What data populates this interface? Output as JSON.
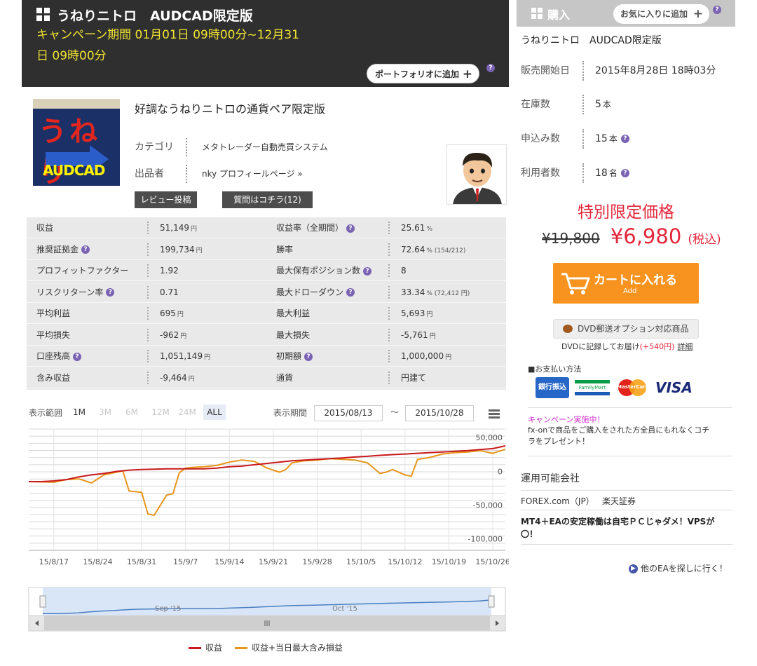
{
  "product": {
    "title": "うねりニトロ　AUDCAD限定版",
    "campaign": "キャンペーン期間 01月01日 09時00分~12月31日 09時00分",
    "portfolio_button": "ポートフォリオに追加",
    "subtitle": "好調なうねりニトロの通貨ペア限定版",
    "category_label": "カテゴリ",
    "category_value": "メタトレーダー自動売買システム",
    "seller_label": "出品者",
    "seller_value": "nky プロフィールページ »",
    "review_button": "レビュー投稿",
    "question_button": "質問はコチラ(12)",
    "thumb_text": "うねり",
    "thumb_name": "AUDCAD"
  },
  "stats": [
    {
      "l_label": "収益",
      "l_help": false,
      "l_value": "51,149",
      "l_unit": "円",
      "r_label": "収益率（全期間）",
      "r_help": true,
      "r_value": "25.61",
      "r_unit": "%",
      "r_extra": ""
    },
    {
      "l_label": "推奨証拠金",
      "l_help": true,
      "l_value": "199,734",
      "l_unit": "円",
      "r_label": "勝率",
      "r_help": false,
      "r_value": "72.64",
      "r_unit": "%",
      "r_extra": "(154/212)"
    },
    {
      "l_label": "プロフィットファクター",
      "l_help": false,
      "l_value": "1.92",
      "l_unit": "",
      "r_label": "最大保有ポジション数",
      "r_help": true,
      "r_value": "8",
      "r_unit": "",
      "r_extra": ""
    },
    {
      "l_label": "リスクリターン率",
      "l_help": true,
      "l_value": "0.71",
      "l_unit": "",
      "r_label": "最大ドローダウン",
      "r_help": true,
      "r_value": "33.34",
      "r_unit": "%",
      "r_extra": "(72,412 円)"
    },
    {
      "l_label": "平均利益",
      "l_help": false,
      "l_value": "695",
      "l_unit": "円",
      "r_label": "最大利益",
      "r_help": false,
      "r_value": "5,693",
      "r_unit": "円",
      "r_extra": ""
    },
    {
      "l_label": "平均損失",
      "l_help": false,
      "l_value": "-962",
      "l_unit": "円",
      "r_label": "最大損失",
      "r_help": false,
      "r_value": "-5,761",
      "r_unit": "円",
      "r_extra": ""
    },
    {
      "l_label": "口座残高",
      "l_help": true,
      "l_value": "1,051,149",
      "l_unit": "円",
      "r_label": "初期額",
      "r_help": true,
      "r_value": "1,000,000",
      "r_unit": "円",
      "r_extra": ""
    },
    {
      "l_label": "含み収益",
      "l_help": false,
      "l_value": "-9,464",
      "l_unit": "円",
      "r_label": "通貨",
      "r_help": false,
      "r_value": "円建て",
      "r_unit": "",
      "r_extra": ""
    }
  ],
  "chart_controls": {
    "range_label": "表示範囲",
    "zoom": [
      {
        "label": "1M",
        "state": "normal"
      },
      {
        "label": "3M",
        "state": "dim"
      },
      {
        "label": "6M",
        "state": "dim"
      },
      {
        "label": "12M",
        "state": "dim"
      },
      {
        "label": "24M",
        "state": "dim"
      },
      {
        "label": "ALL",
        "state": "selected"
      }
    ],
    "period_label": "表示期間",
    "from_date": "2015/08/13",
    "tilde": "～",
    "to_date": "2015/10/28"
  },
  "chart_data": {
    "type": "line",
    "x_tick_labels": [
      "15/8/17",
      "15/8/24",
      "15/8/31",
      "15/9/7",
      "15/9/14",
      "15/9/21",
      "15/9/28",
      "15/10/5",
      "15/10/12",
      "15/10/19",
      "15/10/26"
    ],
    "x_range_days": [
      0,
      76
    ],
    "x_tick_days": [
      4,
      11,
      18,
      25,
      32,
      39,
      46,
      53,
      60,
      67,
      74
    ],
    "y_tick_labels": [
      "50,000",
      "0",
      "-50,000",
      "-100,000"
    ],
    "y_tick_values": [
      50000,
      0,
      -50000,
      -100000
    ],
    "ylim": [
      -110000,
      70000
    ],
    "series": [
      {
        "name": "収益",
        "color": "#c8191c",
        "days": [
          0,
          2,
          4,
          6,
          8,
          10,
          12,
          14,
          16,
          18,
          20,
          22,
          24,
          26,
          28,
          30,
          32,
          34,
          36,
          38,
          40,
          42,
          44,
          46,
          48,
          50,
          52,
          54,
          56,
          58,
          60,
          62,
          64,
          66,
          68,
          70,
          72,
          74,
          76
        ],
        "values": [
          -8000,
          -8000,
          -7000,
          -5000,
          -1000,
          2000,
          4000,
          7000,
          9000,
          10000,
          10500,
          11000,
          11000,
          11000,
          11000,
          12000,
          14000,
          15000,
          17000,
          19000,
          21000,
          23000,
          24000,
          25000,
          26000,
          27000,
          28500,
          29500,
          31000,
          32000,
          33000,
          34000,
          35000,
          36000,
          37000,
          38000,
          39500,
          41000,
          45000
        ]
      },
      {
        "name": "収益+当日最大含み損益",
        "color": "#e8951b",
        "days": [
          0,
          2,
          4,
          6,
          8,
          10,
          12,
          14,
          15,
          16,
          18,
          19,
          20,
          22,
          23,
          24,
          25,
          26,
          28,
          30,
          32,
          34,
          36,
          38,
          40,
          41,
          42,
          44,
          46,
          48,
          50,
          52,
          54,
          56,
          57,
          58,
          60,
          61,
          62,
          64,
          66,
          68,
          70,
          72,
          74,
          76
        ],
        "values": [
          -8000,
          -8500,
          -9000,
          -5000,
          -4000,
          -10000,
          2000,
          6000,
          8000,
          -22000,
          -24000,
          -56000,
          -58000,
          -28000,
          -26000,
          5000,
          12000,
          13000,
          14000,
          16000,
          21000,
          24000,
          22000,
          12000,
          6000,
          10000,
          20000,
          23000,
          24000,
          26000,
          25000,
          24000,
          20000,
          4000,
          6000,
          10000,
          2000,
          0,
          25000,
          28000,
          33000,
          35000,
          36000,
          38000,
          34000,
          40000
        ]
      }
    ],
    "navigator_labels": [
      "Sep '15",
      "Oct '15"
    ],
    "legend": "bottom-center"
  },
  "buy": {
    "header": "購入",
    "fav_button": "お気に入りに追加",
    "name": "うねりニトロ　AUDCAD限定版",
    "rows": [
      {
        "label": "販売開始日",
        "value": "2015年8月28日 18時03分",
        "unit": "",
        "help": false
      },
      {
        "label": "在庫数",
        "value": "5",
        "unit": "本",
        "help": false
      },
      {
        "label": "申込み数",
        "value": "15",
        "unit": "本",
        "help": true
      },
      {
        "label": "利用者数",
        "value": "18",
        "unit": "名",
        "help": true
      }
    ],
    "special_label": "特別限定価格",
    "old_price": "¥19,800",
    "new_price": "¥6,980",
    "tax_label": "(税込)",
    "cart_main": "カートに入れる",
    "cart_sub": "Add",
    "dvd_button": "DVD郵送オプション対応商品",
    "dvd_note": "DVDに記録してお届け",
    "dvd_extra": "(+540円)",
    "dvd_link": "詳細",
    "pay_label": "■お支払い方法",
    "pay_methods": [
      "銀行振込",
      "FamilyMart",
      "MasterCard",
      "VISA"
    ],
    "campaign_title": "キャンペーン実施中！",
    "campaign_text": "fx-onで商品をご購入をされた方全員にもれなくコチラをプレゼント！",
    "brokers_title": "運用可能会社",
    "brokers": [
      "FOREX.com（JP）",
      "楽天証券"
    ],
    "mt4_text": "MT4＋EAの安定稼働は自宅ＰＣじゃダメ！VPSが〇！",
    "search_link": "他のEAを探しに行く！"
  },
  "help_glyph": "?",
  "plus_glyph": "+"
}
